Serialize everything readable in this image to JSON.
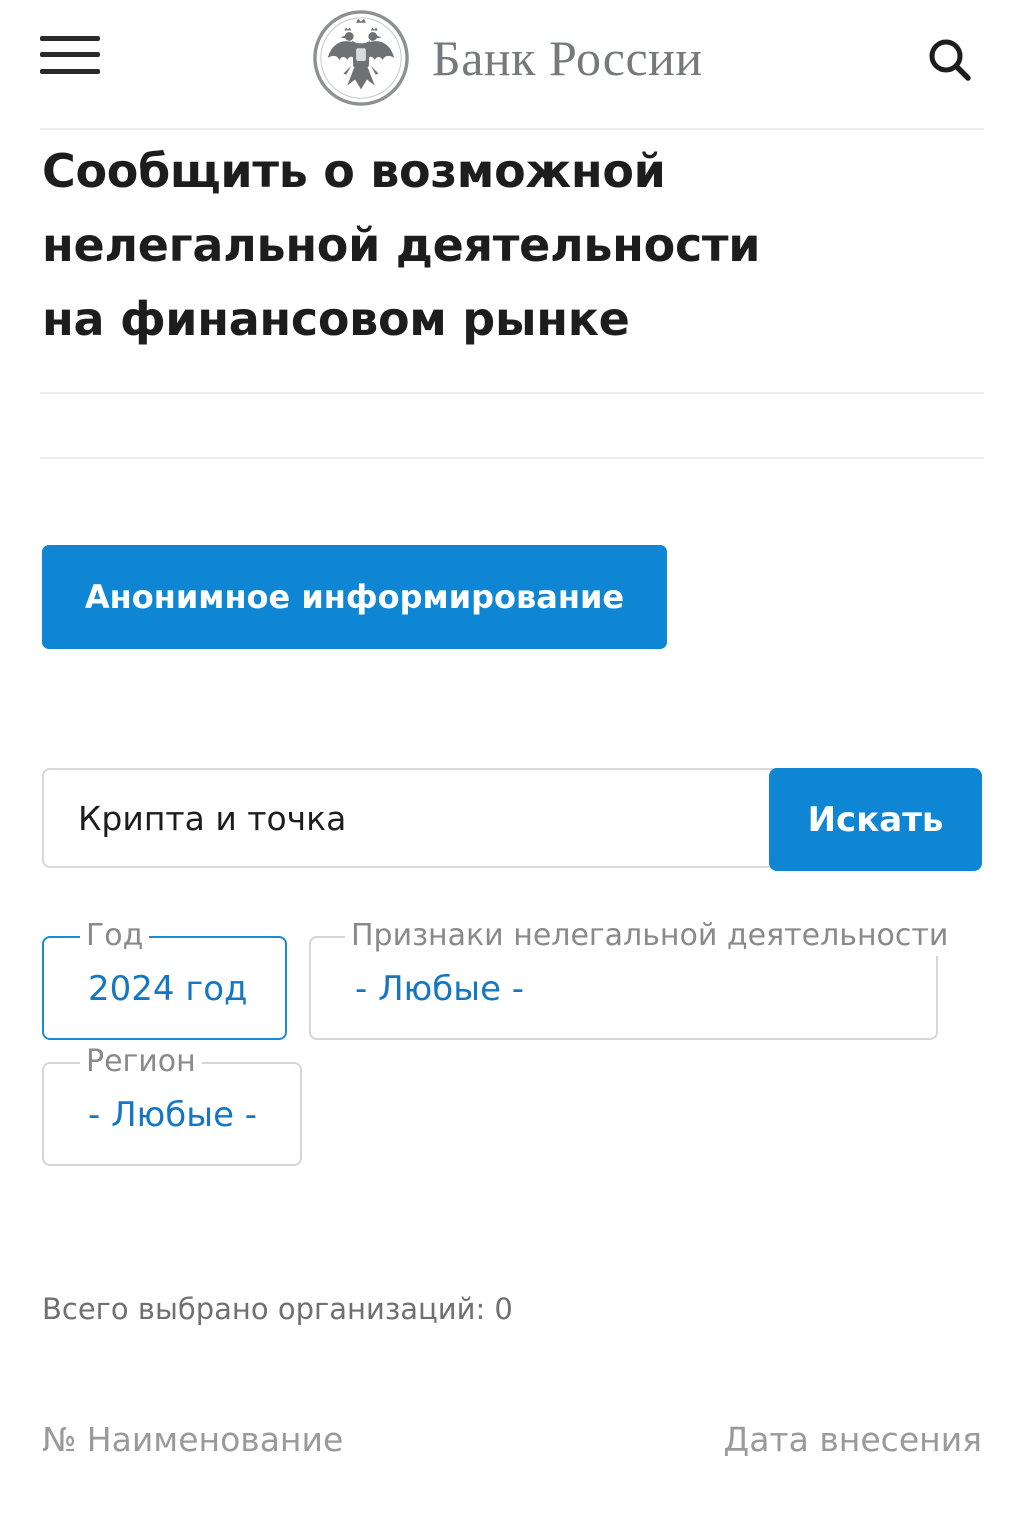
{
  "header": {
    "logo_text": "Банк России",
    "menu_icon": "hamburger-menu-icon",
    "logo_icon": "double-headed-eagle-emblem-icon",
    "search_icon": "search-icon"
  },
  "page": {
    "title_lines": [
      "Сообщить о возможной",
      "нелегальной деятельности",
      "на финансовом рынке"
    ]
  },
  "actions": {
    "anonymous_button": "Анонимное информирование"
  },
  "search": {
    "value": "Крипта и точка",
    "submit_label": "Искать"
  },
  "filters": {
    "year": {
      "label": "Год",
      "value": "2024 год"
    },
    "signs": {
      "label": "Признаки нелегальной деятельности",
      "value": "- Любые -"
    },
    "region": {
      "label": "Регион",
      "value": "- Любые -"
    }
  },
  "results": {
    "total_text": "Всего выбрано организаций: 0",
    "columns": {
      "number_name": "№ Наименование",
      "date_added": "Дата внесения"
    }
  },
  "colors": {
    "accent": "#0f86d3",
    "accent_text": "#1577c2",
    "logo_gray": "#77797c"
  }
}
